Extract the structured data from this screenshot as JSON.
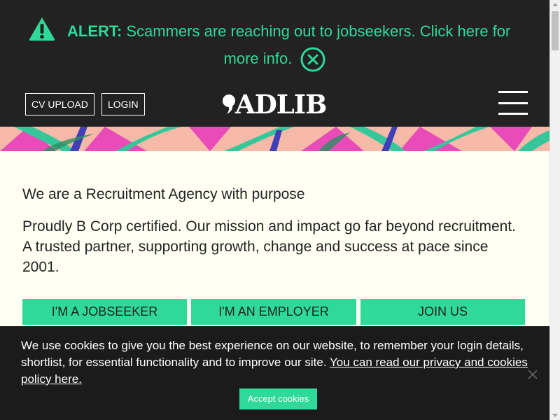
{
  "alert": {
    "label": "ALERT:",
    "message_line1": "Scammers are reaching out to jobseekers. Click here for",
    "message_line2": "more info.",
    "icon": "warning-triangle-icon",
    "close_icon": "close-circle-icon"
  },
  "header": {
    "cv_upload_label": "CV UPLOAD",
    "login_label": "LOGIN",
    "logo_text": "ADLIB",
    "menu_icon": "hamburger-menu-icon"
  },
  "hero": {
    "heading": "We are a Recruitment Agency with purpose",
    "intro": "Proudly B Corp certified. Our mission and impact go far beyond recruitment. A trusted partner, supporting growth, change and success at pace since 2001.",
    "buttons": [
      {
        "label": "I'M A JOBSEEKER"
      },
      {
        "label": "I'M AN EMPLOYER"
      },
      {
        "label": "JOIN US"
      }
    ]
  },
  "cookie": {
    "text": "We use cookies to give you the best experience on our website, to remember your login details, shortlist, for essential functionality and to improve our site. ",
    "link_text": "You can read our privacy and cookies policy here.",
    "accept_label": "Accept cookies",
    "close_icon": "close-x-icon"
  },
  "colors": {
    "accent": "#2ed99a",
    "dark": "#222222",
    "cream": "#fffff4",
    "banner_pink": "#f7b9a8",
    "banner_magenta": "#e94bb8"
  }
}
